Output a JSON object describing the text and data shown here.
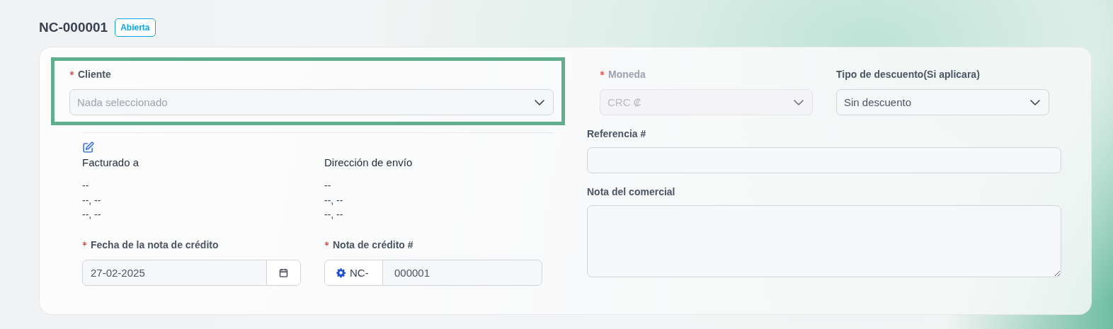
{
  "header": {
    "title": "NC-000001",
    "status": "Abierta"
  },
  "client": {
    "label": "Cliente",
    "required": true,
    "highlighted": true,
    "kind": "select",
    "placeholder": "Nada seleccionado"
  },
  "address_blocks": [
    {
      "title": "Facturado a",
      "lines": [
        "--",
        "--, --",
        "--, --"
      ]
    },
    {
      "title": "Dirección de envío",
      "lines": [
        "--",
        "--, --",
        "--, --"
      ]
    }
  ],
  "left_fields": [
    {
      "label": "Fecha de la nota de crédito",
      "required": true,
      "kind": "date",
      "value": "27-02-2025"
    },
    {
      "label": "Nota de crédito #",
      "required": true,
      "kind": "prefixed",
      "prefix": "NC-",
      "value": "000001"
    }
  ],
  "top_right_fields": [
    {
      "label": "Moneda",
      "required": true,
      "disabled": true,
      "kind": "select",
      "value": "CRC ₡"
    },
    {
      "label": "Tipo de descuento(Si aplicara)",
      "required": false,
      "disabled": false,
      "kind": "select",
      "value": "Sin descuento"
    }
  ],
  "right_fields": [
    {
      "label": "Referencia #",
      "kind": "input"
    },
    {
      "label": "Nota del comercial",
      "kind": "textarea"
    }
  ]
}
